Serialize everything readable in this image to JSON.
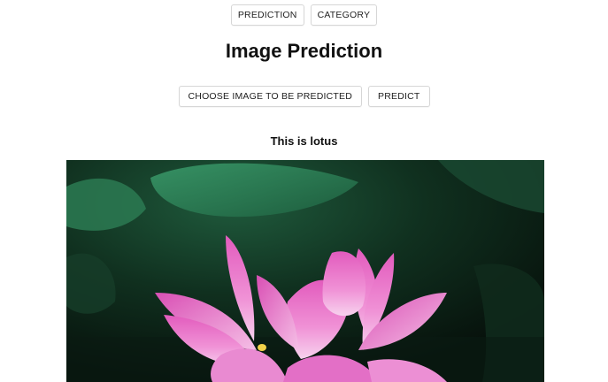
{
  "nav": {
    "prediction_label": "PREDICTION",
    "category_label": "CATEGORY"
  },
  "page": {
    "title": "Image Prediction"
  },
  "actions": {
    "choose_label": "CHOOSE IMAGE TO BE PREDICTED",
    "predict_label": "PREDICT"
  },
  "result": {
    "text": "This is lotus"
  },
  "colors": {
    "petal_pink": "#e46fc4",
    "petal_light": "#f6c6ea",
    "leaf_green": "#2f8a5c",
    "background_dark": "#0c1a14"
  }
}
